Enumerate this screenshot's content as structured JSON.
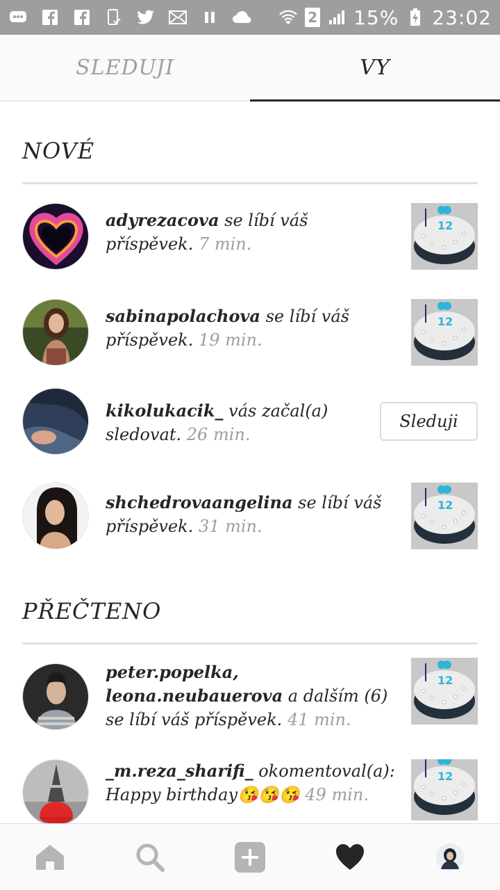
{
  "status_bar": {
    "battery": "15%",
    "time": "23:02",
    "sim": "2"
  },
  "tabs": [
    {
      "label": "SLEDUJI",
      "active": false
    },
    {
      "label": "VY",
      "active": true
    }
  ],
  "sections": {
    "new_title": "NOVÉ",
    "read_title": "PŘEČTENO"
  },
  "notifications": [
    {
      "user": "adyrezacova",
      "action": " se líbí váš příspěvek.",
      "time": " 7 min.",
      "type": "like"
    },
    {
      "user": "sabinapolachova",
      "action": " se líbí váš příspěvek.",
      "time": " 19 min.",
      "type": "like"
    },
    {
      "user": "kikolukacik_",
      "action": " vás začal(a) sledovat.",
      "time": " 26 min.",
      "type": "follow",
      "button": "Sleduji"
    },
    {
      "user": "shchedrovaangelina",
      "action": " se líbí váš příspěvek.",
      "time": " 31 min.",
      "type": "like"
    }
  ],
  "read_notifications": [
    {
      "user": "peter.popelka,\nleona.neubauerova",
      "action": " a dalším (6) se líbí váš příspěvek.",
      "time": " 41 min.",
      "type": "like"
    },
    {
      "user": "_m.reza_sharifi_",
      "action": " okomentoval(a): Happy birthday😘😘😘",
      "time": " 49 min.",
      "type": "comment"
    }
  ],
  "bottom_nav": [
    "home-icon",
    "search-icon",
    "add-icon",
    "heart-icon",
    "profile-icon"
  ],
  "colors": {
    "status_bar": "#9e9e9e",
    "text": "#262626",
    "muted": "#9e9e9e",
    "divider": "#e0e0e0"
  }
}
